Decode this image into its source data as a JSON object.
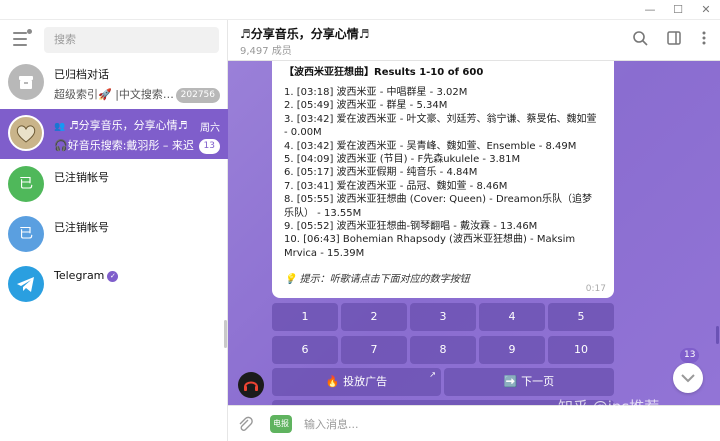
{
  "window": {
    "minimize": "—",
    "maximize": "☐",
    "close": "✕"
  },
  "search": {
    "placeholder": "搜索"
  },
  "chats": [
    {
      "title": "已归档对话",
      "subtitle": "超级索引🚀 |中文搜索…",
      "badge": "202756",
      "avatar_icon": "archive-icon",
      "avatar_color": "#b8b8b8"
    },
    {
      "title": "♬分享音乐，分享心情♬",
      "subtitle": "🎧好音乐搜索:戴羽彤 – 来迟…",
      "day": "周六",
      "badge": "13",
      "avatar_icon": "group-avatar",
      "avatar_color": "#c9b48a"
    },
    {
      "title": "已注销帐号",
      "avatar_text": "已",
      "avatar_color": "#4fb85a"
    },
    {
      "title": "已注销帐号",
      "avatar_text": "已",
      "avatar_color": "#5a9fe0"
    },
    {
      "title": "Telegram",
      "avatar_icon": "telegram-icon",
      "avatar_color": "#2a9fe0"
    }
  ],
  "header": {
    "title": "♬分享音乐，分享心情♬",
    "subtitle": "9,497 成员"
  },
  "message": {
    "heading": "【波西米亚狂想曲】Results 1-10 of 600",
    "lines": [
      "1. [03:18] 波西米亚 - 中唱群星 - 3.02M",
      "2. [05:49] 波西米亚 - 群星 - 5.34M",
      "3. [03:42] 爱在波西米亚 - 叶文豪、刘廷芳、翁宁谦、蔡旻佑、魏如萱 - 0.00M",
      "4. [03:42] 爱在波西米亚 - 吴青峰、魏如萱、Ensemble - 8.49M",
      "5. [04:09] 波西米亚 (节目) - F先森ukulele - 3.81M",
      "6. [05:17] 波西米亚假期 - 纯音乐 - 4.84M",
      "7. [03:41] 爱在波西米亚 - 品冠、魏如萱 - 8.46M",
      "8. [05:55] 波西米亚狂想曲 (Cover: Queen) - Dreamon乐队（追梦乐队） - 13.55M",
      "9. [05:52] 波西米亚狂想曲-钢琴翻唱 - 戴汝霖 - 13.46M",
      "10. [06:43] Bohemian Rhapsody (波西米亚狂想曲) - Maksim Mrvica - 15.39M"
    ],
    "hint": "💡 提示：听歌请点击下面对应的数字按钮",
    "time": "0:17"
  },
  "keyboard": {
    "row1": [
      "1",
      "2",
      "3",
      "4",
      "5"
    ],
    "row2": [
      "6",
      "7",
      "8",
      "9",
      "10"
    ],
    "ad": "🔥 投放广告",
    "next": "➡️ 下一页"
  },
  "scroll": {
    "unread_count": "13"
  },
  "input": {
    "placeholder": "输入消息...",
    "bot_menu": "电报"
  },
  "watermark": "知乎 @ins推荐"
}
